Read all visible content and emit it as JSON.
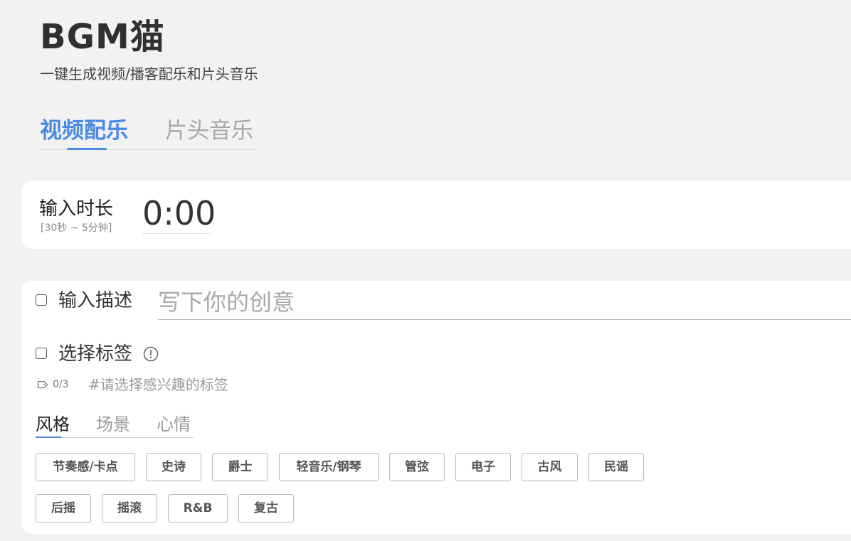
{
  "app": {
    "logo": "BGM猫",
    "subtitle": "一键生成视频/播客配乐和片头音乐"
  },
  "main_tabs": [
    {
      "label": "视频配乐",
      "active": true
    },
    {
      "label": "片头音乐",
      "active": false
    }
  ],
  "duration": {
    "label": "输入时长",
    "range": "[30秒 ~ 5分钟]",
    "value": "0:00"
  },
  "description": {
    "label": "输入描述",
    "placeholder": "写下你的创意",
    "checked": false
  },
  "tags": {
    "label": "选择标签",
    "checked": false,
    "count": "0/3",
    "hint": "#请选择感兴趣的标签",
    "sub_tabs": [
      {
        "label": "风格",
        "active": true
      },
      {
        "label": "场景",
        "active": false
      },
      {
        "label": "心情",
        "active": false
      }
    ],
    "options": [
      "节奏感/卡点",
      "史诗",
      "爵士",
      "轻音乐/钢琴",
      "管弦",
      "电子",
      "古风",
      "民谣",
      "后摇",
      "摇滚",
      "R&B",
      "复古"
    ]
  },
  "colors": {
    "accent": "#4a8ae2",
    "background": "#f2f2f2",
    "card": "#ffffff"
  }
}
